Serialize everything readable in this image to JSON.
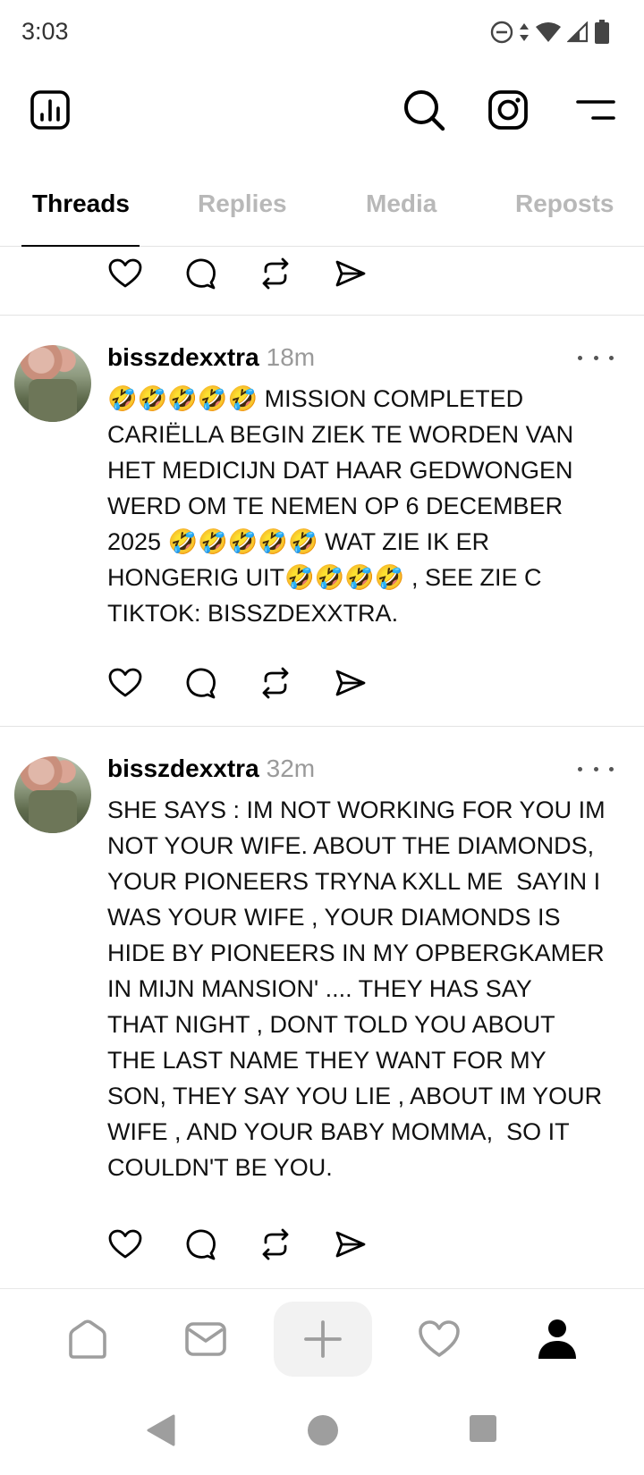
{
  "status_bar": {
    "time": "3:03"
  },
  "tabs": [
    {
      "label": "Threads",
      "active": true
    },
    {
      "label": "Replies",
      "active": false
    },
    {
      "label": "Media",
      "active": false
    },
    {
      "label": "Reposts",
      "active": false
    }
  ],
  "posts": [
    {
      "username": "bisszdexxtra",
      "time": "18m",
      "text": "🤣🤣🤣🤣🤣 MISSION COMPLETED\nCARIËLLA BEGIN ZIEK TE WORDEN VAN\nHET MEDICIJN DAT HAAR GEDWONGEN\nWERD OM TE NEMEN OP 6 DECEMBER\n2025 🤣🤣🤣🤣🤣 WAT ZIE IK ER\nHONGERIG UIT🤣🤣🤣🤣 , SEE ZIE C\nTIKTOK: BISSZDEXXTRA."
    },
    {
      "username": "bisszdexxtra",
      "time": "32m",
      "text": "SHE SAYS : IM NOT WORKING FOR YOU IM\nNOT YOUR WIFE. ABOUT THE DIAMONDS,\nYOUR PIONEERS TRYNA KXLL ME  SAYIN I\nWAS YOUR WIFE , YOUR DIAMONDS IS\nHIDE BY PIONEERS IN MY OPBERGKAMER\nIN MIJN MANSION' .... THEY HAS SAY\nTHAT NIGHT , DONT TOLD YOU ABOUT\nTHE LAST NAME THEY WANT FOR MY\nSON, THEY SAY YOU LIE , ABOUT IM YOUR\nWIFE , AND YOUR BABY MOMMA,  SO IT\nCOULDN'T BE YOU."
    }
  ],
  "icons": {
    "header": [
      "insights-icon",
      "search-icon",
      "instagram-icon",
      "menu-icon"
    ],
    "actions": [
      "heart-icon",
      "comment-icon",
      "repost-icon",
      "share-icon"
    ],
    "bottom_nav": [
      "home-icon",
      "inbox-icon",
      "create-icon",
      "activity-icon",
      "profile-icon"
    ]
  }
}
